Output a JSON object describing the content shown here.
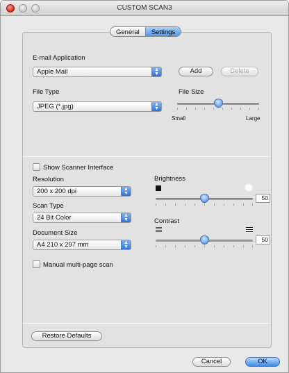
{
  "window": {
    "title": "CUSTOM SCAN3"
  },
  "tabs": [
    {
      "label": "General"
    },
    {
      "label": "Settings"
    }
  ],
  "email": {
    "label": "E-mail Application",
    "value": "Apple Mail",
    "add_label": "Add",
    "delete_label": "Delete"
  },
  "file_type": {
    "label": "File Type",
    "value": "JPEG (*.jpg)"
  },
  "file_size": {
    "label": "File Size",
    "min_label": "Small",
    "max_label": "Large",
    "level_fraction": 0.5
  },
  "scanner_interface": {
    "label": "Show Scanner Interface",
    "checked": false
  },
  "resolution": {
    "label": "Resolution",
    "value": "200 x 200 dpi"
  },
  "scan_type": {
    "label": "Scan Type",
    "value": "24 Bit Color"
  },
  "document_size": {
    "label": "Document Size",
    "value": "A4  210 x 297 mm"
  },
  "multipage": {
    "label": "Manual multi-page scan",
    "checked": false
  },
  "brightness": {
    "label": "Brightness",
    "value": "50"
  },
  "contrast": {
    "label": "Contrast",
    "value": "50"
  },
  "restore_label": "Restore Defaults",
  "cancel_label": "Cancel",
  "ok_label": "OK"
}
